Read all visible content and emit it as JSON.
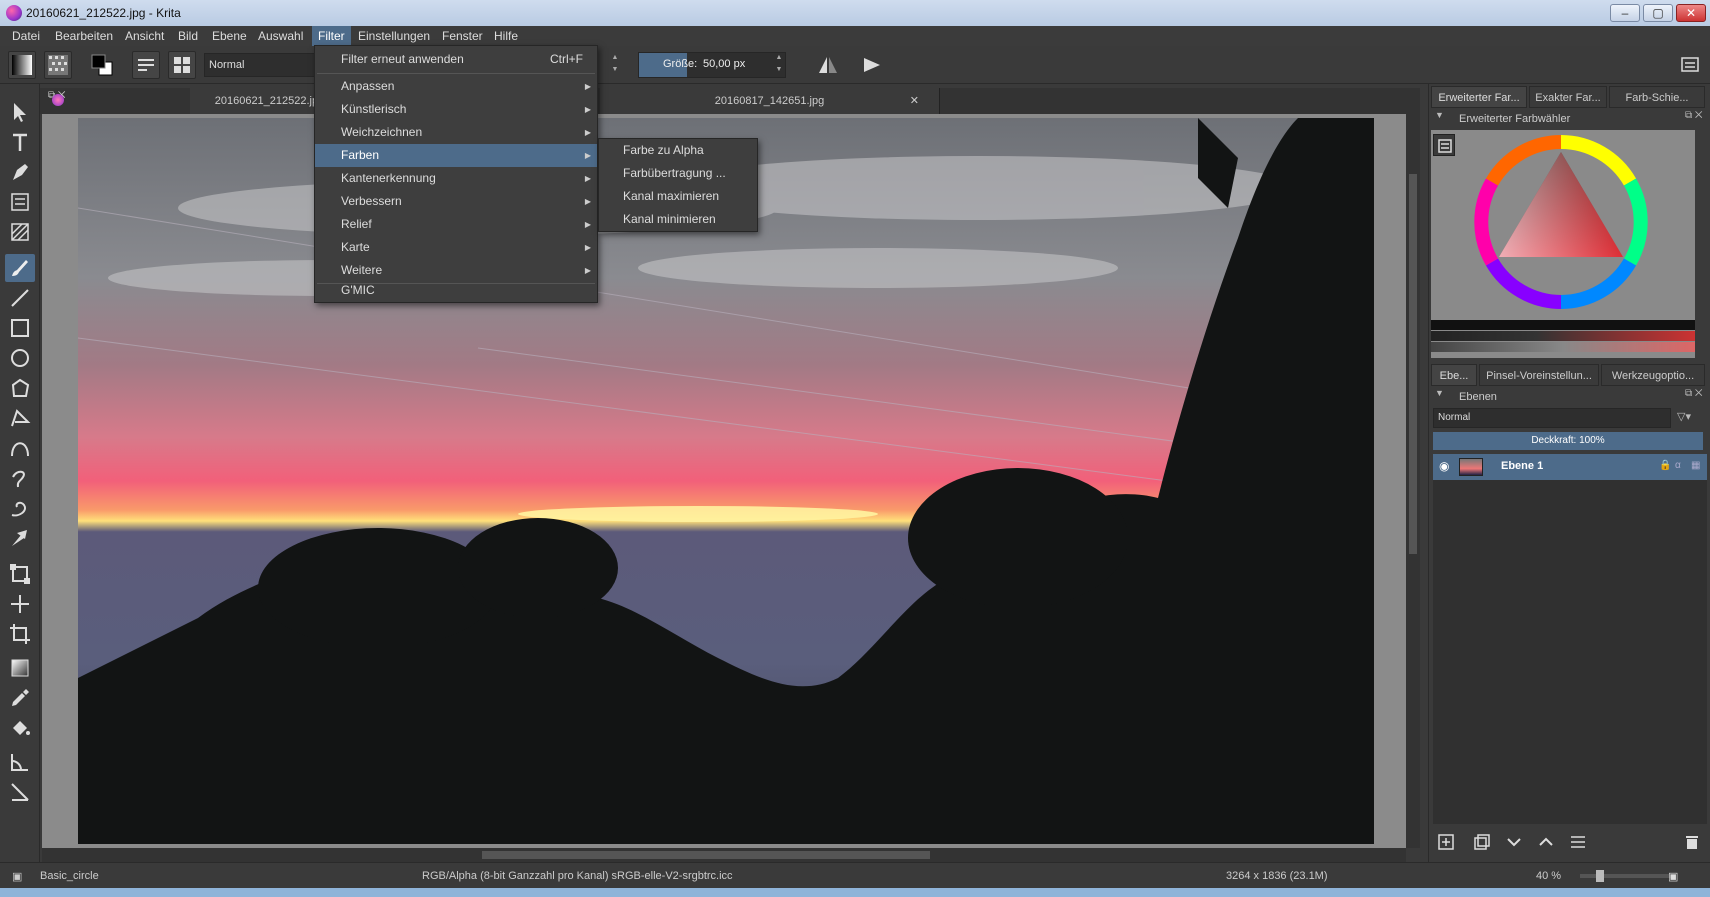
{
  "window": {
    "title": "20160621_212522.jpg  - Krita",
    "minimize_icon": "minimize-icon",
    "maximize_icon": "maximize-icon",
    "close_icon": "close-icon"
  },
  "menubar": {
    "items": [
      "Datei",
      "Bearbeiten",
      "Ansicht",
      "Bild",
      "Ebene",
      "Auswahl",
      "Filter",
      "Einstellungen",
      "Fenster",
      "Hilfe"
    ],
    "active": "Filter"
  },
  "toolbar": {
    "blend_mode": "Normal",
    "size_label": "Größe:",
    "size_value": "50,00 px"
  },
  "document_tabs": [
    "20160621_212522.jpg",
    "20160817_142651.jpg"
  ],
  "filter_menu": {
    "items": [
      {
        "label": "Filter erneut anwenden",
        "shortcut": "Ctrl+F",
        "submenu": false
      },
      {
        "label": "Anpassen",
        "submenu": true
      },
      {
        "label": "Künstlerisch",
        "submenu": true
      },
      {
        "label": "Weichzeichnen",
        "submenu": true
      },
      {
        "label": "Farben",
        "submenu": true,
        "highlighted": true
      },
      {
        "label": "Kantenerkennung",
        "submenu": true
      },
      {
        "label": "Verbessern",
        "submenu": true
      },
      {
        "label": "Relief",
        "submenu": true
      },
      {
        "label": "Karte",
        "submenu": true
      },
      {
        "label": "Weitere",
        "submenu": true
      },
      {
        "label": "G'MIC",
        "submenu": false
      }
    ]
  },
  "farben_submenu": {
    "items": [
      "Farbe zu Alpha",
      "Farbübertragung ...",
      "Kanal maximieren",
      "Kanal minimieren"
    ]
  },
  "right_panel": {
    "top_tabs": [
      "Erweiterter Far...",
      "Exakter Far...",
      "Farb-Schie..."
    ],
    "color_docker_title": "Erweiterter Farbwähler",
    "mid_tabs": [
      "Ebe...",
      "Pinsel-Voreinstellun...",
      "Werkzeugoptio..."
    ],
    "layers_docker_title": "Ebenen",
    "layers_blend_mode": "Normal",
    "opacity_label": "Deckkraft:  100%",
    "layers": [
      {
        "name": "Ebene 1",
        "visible": true
      }
    ]
  },
  "statusbar": {
    "brush": "Basic_circle",
    "color_info": "RGB/Alpha (8-bit Ganzzahl pro Kanal)  sRGB-elle-V2-srgbtrc.icc",
    "image_size": "3264 x 1836 (23.1M)",
    "zoom": "40 %"
  },
  "colors": {
    "accent": "#4d6b8a",
    "panel": "#3a3a3a",
    "menu": "#3e3e3e",
    "canvas_bg": "#8b8b8b"
  }
}
